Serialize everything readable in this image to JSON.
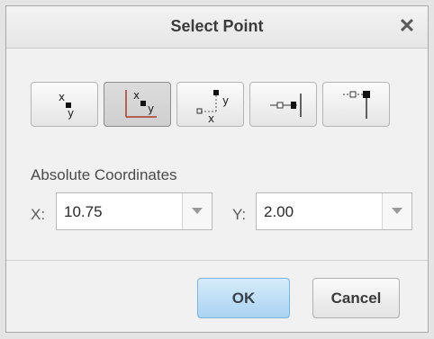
{
  "dialog": {
    "title": "Select Point",
    "close_glyph": "✕"
  },
  "toolbar": {
    "buttons": [
      {
        "icon": "absolute-xy-icon",
        "label_x": "x",
        "label_y": "y",
        "active": false
      },
      {
        "icon": "relative-xy-corner-icon",
        "label_x": "x",
        "label_y": "y",
        "active": true
      },
      {
        "icon": "relative-xy-origin-icon",
        "label_x": "x",
        "label_y": "y",
        "active": false
      },
      {
        "icon": "point-on-line-icon",
        "active": false
      },
      {
        "icon": "point-vertical-offset-icon",
        "active": false
      }
    ]
  },
  "coordinates": {
    "section_label": "Absolute Coordinates",
    "x_label": "X:",
    "x_value": "10.75",
    "y_label": "Y:",
    "y_value": "2.00"
  },
  "actions": {
    "ok_label": "OK",
    "cancel_label": "Cancel"
  },
  "colors": {
    "ok_accent": "#aad3f2",
    "active_tool": "#cfcfcf"
  }
}
